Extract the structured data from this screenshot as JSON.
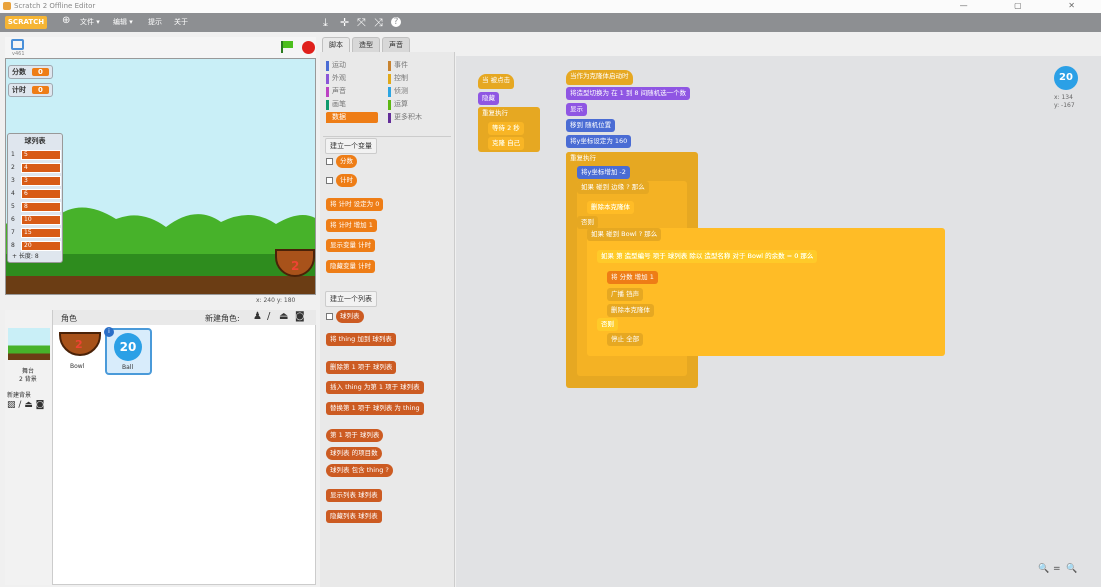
{
  "titlebar": {
    "title": "Scratch 2 Offline Editor"
  },
  "menubar": {
    "logo": "SCRATCH",
    "globe": "⊕",
    "items": [
      "文件 ▾",
      "编辑 ▾",
      "提示",
      "关于"
    ],
    "tools": [
      "⤓",
      "✛",
      "⤧",
      "⤨",
      "?"
    ]
  },
  "stage": {
    "coords": "x: 240  y: 180",
    "version": "v461"
  },
  "monitors": {
    "score_label": "分数",
    "score_value": "0",
    "timer_label": "计时",
    "timer_value": "0"
  },
  "list": {
    "title": "球列表",
    "items": [
      "5",
      "4",
      "3",
      "6",
      "8",
      "10",
      "15",
      "20"
    ],
    "length": "+ 长度: 8"
  },
  "sprites": {
    "header": "角色",
    "new_sprite": "新建角色:",
    "stage_label": "舞台",
    "stage_bg": "2 背景",
    "new_bg": "新建背景",
    "items": [
      {
        "name": "Bowl",
        "number": "2"
      },
      {
        "name": "Ball",
        "number": "20"
      }
    ],
    "selected_badge": "i"
  },
  "tabs": [
    "脚本",
    "造型",
    "声音"
  ],
  "categories": [
    [
      "运动",
      "#4a6cd4"
    ],
    [
      "事件",
      "#c88330"
    ],
    [
      "外观",
      "#8a55d7"
    ],
    [
      "控制",
      "#e1a91a"
    ],
    [
      "声音",
      "#bb42c3"
    ],
    [
      "侦测",
      "#2ca5e2"
    ],
    [
      "画笔",
      "#0e9a6c"
    ],
    [
      "运算",
      "#5cb712"
    ],
    [
      "数据",
      "#ee7d16"
    ],
    [
      "更多积木",
      "#632d99"
    ]
  ],
  "palette": {
    "make_var": "建立一个变量",
    "vars": [
      "分数",
      "计时"
    ],
    "set": "将 计时 设定为 0",
    "change": "将 计时 增加 1",
    "show": "显示变量 计时",
    "hide": "隐藏变量 计时",
    "make_list": "建立一个列表",
    "list_name": "球列表",
    "add": "将 thing 加到 球列表",
    "del": "删除第 1 项于 球列表",
    "insert": "插入 thing 为第 1 项于 球列表",
    "replace": "替换第 1 项于 球列表 为 thing",
    "item": "第 1 项于 球列表",
    "length": "球列表 的项目数",
    "contains": "球列表 包含 thing ?",
    "showlist": "显示列表 球列表",
    "hidelist": "隐藏列表 球列表"
  },
  "script1": {
    "hat": "当 被点击",
    "hide": "隐藏",
    "forever": "重复执行",
    "wait": "等待 2 秒",
    "clone": "克隆 自己"
  },
  "script2": {
    "hat": "当作为克隆体启动时",
    "costume": "将造型切换为 在 1 到 8 间随机选一个数",
    "show": "显示",
    "goto": "移到 随机位置",
    "sety": "将y坐标设定为 160",
    "forever": "重复执行",
    "changey": "将y坐标增加 -2",
    "if1": "如果 碰到 边缘 ? 那么",
    "del1": "删除本克隆体",
    "else1": "否则",
    "if2": "如果 碰到 Bowl ? 那么",
    "if3": "如果 第 造型编号 项于 球列表 除以 造型名称 对于 Bowl 的余数 = 0 那么",
    "change": "将 分数 增加 1",
    "broadcast": "广播 铛声",
    "del2": "删除本克隆体",
    "else2": "否则",
    "stop": "停止 全部"
  },
  "sprite_info": {
    "number": "20",
    "x": "x: 134",
    "y": "y: -167"
  },
  "zoom": {
    "out": "🔍",
    "reset": "=",
    "in": "🔍"
  }
}
